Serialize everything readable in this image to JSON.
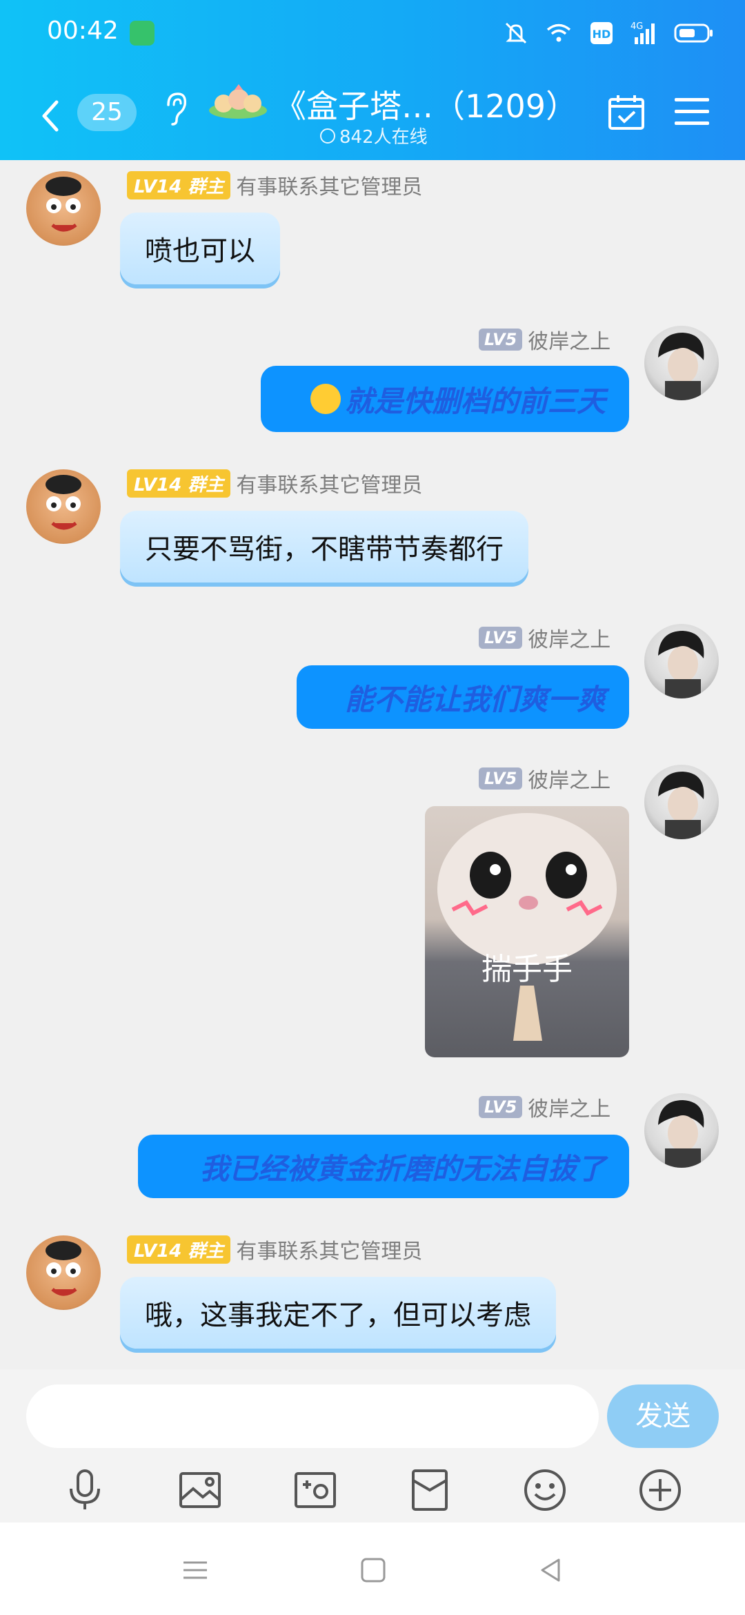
{
  "status_bar": {
    "time": "00:42"
  },
  "header": {
    "unread_count": "25",
    "group_title": "《盒子塔…（1209）",
    "online_text": "842人在线"
  },
  "messages": [
    {
      "sender": "有事联系其它管理员",
      "badge": "LV14 群主",
      "text": "喷也可以"
    },
    {
      "sender": "彼岸之上",
      "badge": "LV5",
      "text": "就是快删档的前三天"
    },
    {
      "sender": "有事联系其它管理员",
      "badge": "LV14 群主",
      "text": "只要不骂街，不瞎带节奏都行"
    },
    {
      "sender": "彼岸之上",
      "badge": "LV5",
      "text": "能不能让我们爽一爽"
    },
    {
      "sender": "彼岸之上",
      "badge": "LV5",
      "sticker_caption": "揣手手"
    },
    {
      "sender": "彼岸之上",
      "badge": "LV5",
      "text": "我已经被黄金折磨的无法自拔了"
    },
    {
      "sender": "有事联系其它管理员",
      "badge": "LV14 群主",
      "text": "哦，这事我定不了，但可以考虑"
    }
  ],
  "input": {
    "placeholder": "",
    "send_label": "发送"
  },
  "toolbar_icons": [
    "microphone-icon",
    "image-icon",
    "camera-icon",
    "red-envelope-icon",
    "emoji-icon",
    "plus-icon"
  ],
  "colors": {
    "header_start": "#10c2f7",
    "header_end": "#1e8ff5",
    "out_bubble": "#0d93ff",
    "owner_badge": "#f7c531"
  }
}
